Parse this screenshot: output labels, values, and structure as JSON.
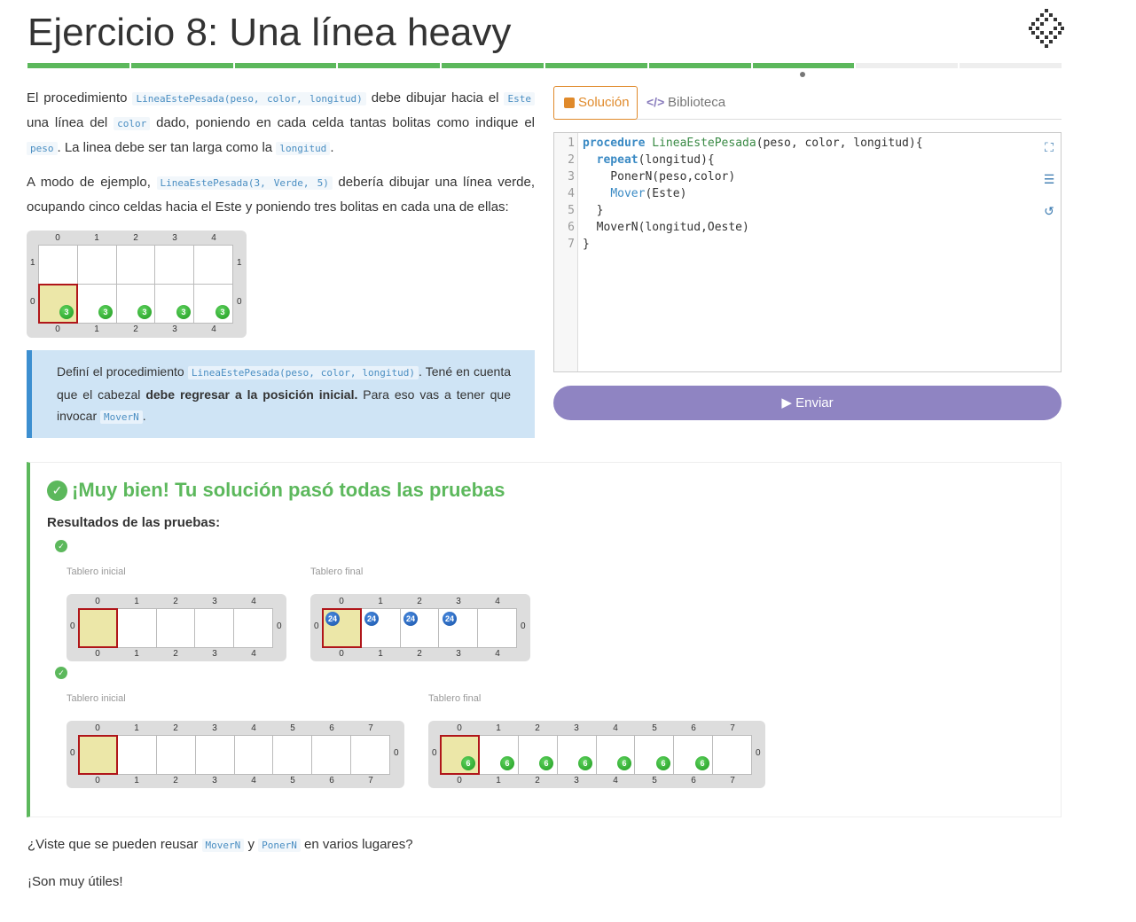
{
  "page": {
    "title": "Ejercicio 8: Una línea heavy"
  },
  "progress": {
    "total_segments": 10,
    "completed_segments": 8
  },
  "description": {
    "p1": [
      "El procedimiento ",
      "LineaEstePesada(peso, color, longitud)",
      " debe dibujar hacia el ",
      "Este",
      " una línea del ",
      "color",
      " dado, poniendo en cada celda tantas bolitas como indique el ",
      "peso",
      ". La linea debe ser tan larga como la ",
      "longitud",
      "."
    ],
    "p2": [
      "A modo de ejemplo, ",
      "LineaEstePesada(3, Verde, 5)",
      " debería dibujar una línea verde, ocupando cinco celdas hacia el Este y poniendo tres bolitas en cada una de ellas:"
    ]
  },
  "example_board": {
    "cols": [
      "0",
      "1",
      "2",
      "3",
      "4"
    ],
    "rows": [
      "1",
      "0"
    ],
    "ball_count": "3"
  },
  "hint": {
    "parts": [
      "Definí el procedimiento ",
      "LineaEstePesada(peso, color, longitud)",
      ". Tené en cuenta que el cabezal ",
      "debe regresar a la posición inicial.",
      " Para eso vas a tener que invocar ",
      "MoverN",
      "."
    ]
  },
  "tabs": {
    "solution": "Solución",
    "library": "Biblioteca"
  },
  "editor": {
    "line_numbers": [
      "1",
      "2",
      "3",
      "4",
      "5",
      "6",
      "7"
    ],
    "lines": [
      [
        "procedure",
        " ",
        "LineaEstePesada",
        "(peso, color, longitud){"
      ],
      [
        "  ",
        "repeat",
        "(longitud){"
      ],
      [
        "    PonerN(peso,color)"
      ],
      [
        "    ",
        "Mover",
        "(Este)"
      ],
      [
        "  }"
      ],
      [
        "  MoverN(longitud,Oeste)"
      ],
      [
        "}"
      ]
    ]
  },
  "send_button": {
    "label": "Enviar"
  },
  "result": {
    "title": "¡Muy bien! Tu solución pasó todas las pruebas",
    "subtitle": "Resultados de las pruebas:",
    "initial_label": "Tablero inicial",
    "final_label": "Tablero final",
    "test1": {
      "cols": [
        "0",
        "1",
        "2",
        "3",
        "4"
      ],
      "row": "0",
      "ball_count": "24",
      "balls_in_cols": 4
    },
    "test2": {
      "cols": [
        "0",
        "1",
        "2",
        "3",
        "4",
        "5",
        "6",
        "7"
      ],
      "row": "0",
      "ball_count": "6",
      "balls_in_cols": 7
    }
  },
  "footer": {
    "q_parts": [
      "¿Viste que se pueden reusar ",
      "MoverN",
      " y ",
      "PonerN",
      " en varios lugares?"
    ],
    "note": "¡Son muy útiles!"
  },
  "colors": {
    "green": "#5cb85c",
    "orange": "#e08a2b",
    "purple": "#8f84c2",
    "blue_ball": "#1f6fd0",
    "green_ball": "#2eb82e"
  }
}
